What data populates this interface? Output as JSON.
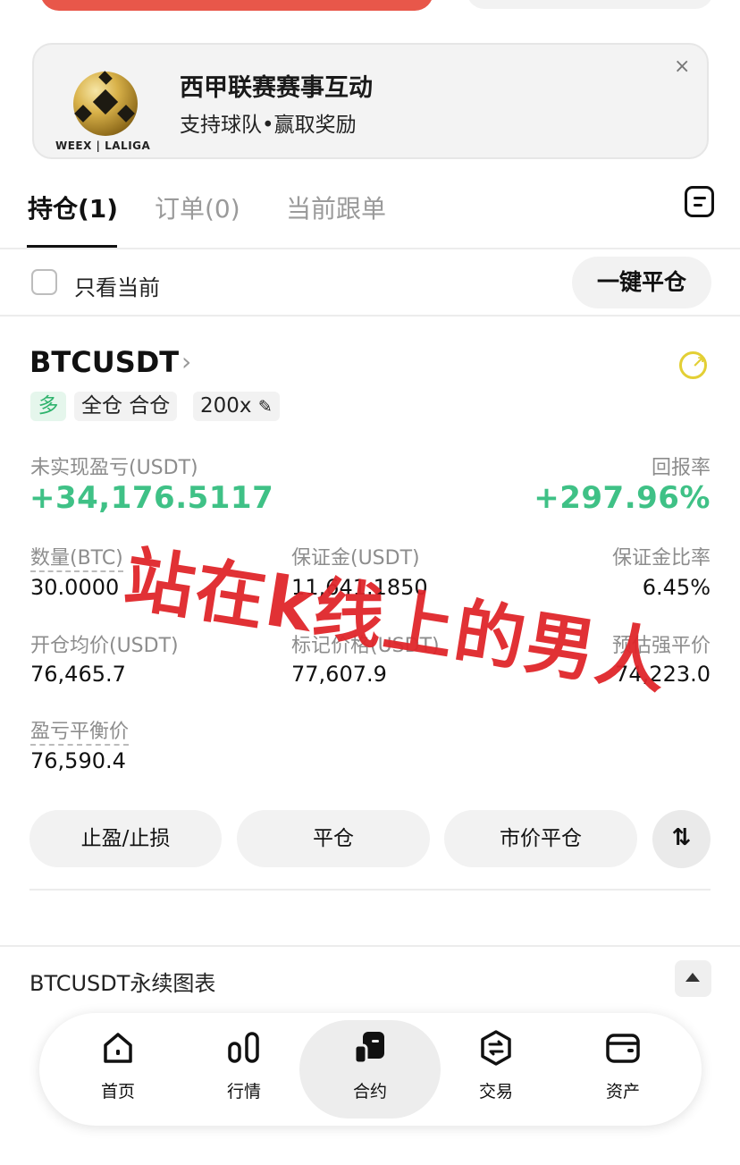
{
  "banner": {
    "title": "西甲联赛赛事互动",
    "subtitle": "支持球队•赢取奖励",
    "logo_text": "WEEX | LALIGA",
    "close": "×"
  },
  "tabs": [
    {
      "label": "持仓(1)",
      "active": true
    },
    {
      "label": "订单(0)",
      "active": false
    },
    {
      "label": "当前跟单",
      "active": false
    }
  ],
  "filter": {
    "label": "只看当前",
    "close_all": "一键平仓"
  },
  "position": {
    "symbol": "BTCUSDT",
    "side": "多",
    "mode": "全仓 合仓",
    "leverage": "200x",
    "pnl_label": "未实现盈亏(USDT)",
    "pnl_value": "+34,176.5117",
    "roe_label": "回报率",
    "roe_value": "+297.96%",
    "qty_label": "数量(BTC)",
    "qty_value": "30.0000",
    "margin_label": "保证金(USDT)",
    "margin_value": "11,641.1850",
    "margin_ratio_label": "保证金比率",
    "margin_ratio_value": "6.45%",
    "entry_label": "开仓均价(USDT)",
    "entry_value": "76,465.7",
    "mark_label": "标记价格(USDT)",
    "mark_value": "77,607.9",
    "liq_label": "预估强平价",
    "liq_value": "74,223.0",
    "breakeven_label": "盈亏平衡价",
    "breakeven_value": "76,590.4",
    "accent_green": "#3fc186",
    "accent_yellow": "#e3cf35"
  },
  "actions": {
    "tpsl": "止盈/止损",
    "close": "平仓",
    "market_close": "市价平仓",
    "swap_icon": "⇅"
  },
  "chart_section": {
    "title": "BTCUSDT永续图表"
  },
  "nav": [
    {
      "label": "首页",
      "icon": "home-icon"
    },
    {
      "label": "行情",
      "icon": "market-icon"
    },
    {
      "label": "合约",
      "icon": "contract-icon",
      "active": true
    },
    {
      "label": "交易",
      "icon": "trade-icon"
    },
    {
      "label": "资产",
      "icon": "wallet-icon"
    }
  ],
  "overlay_text": "站在k线上的男人"
}
